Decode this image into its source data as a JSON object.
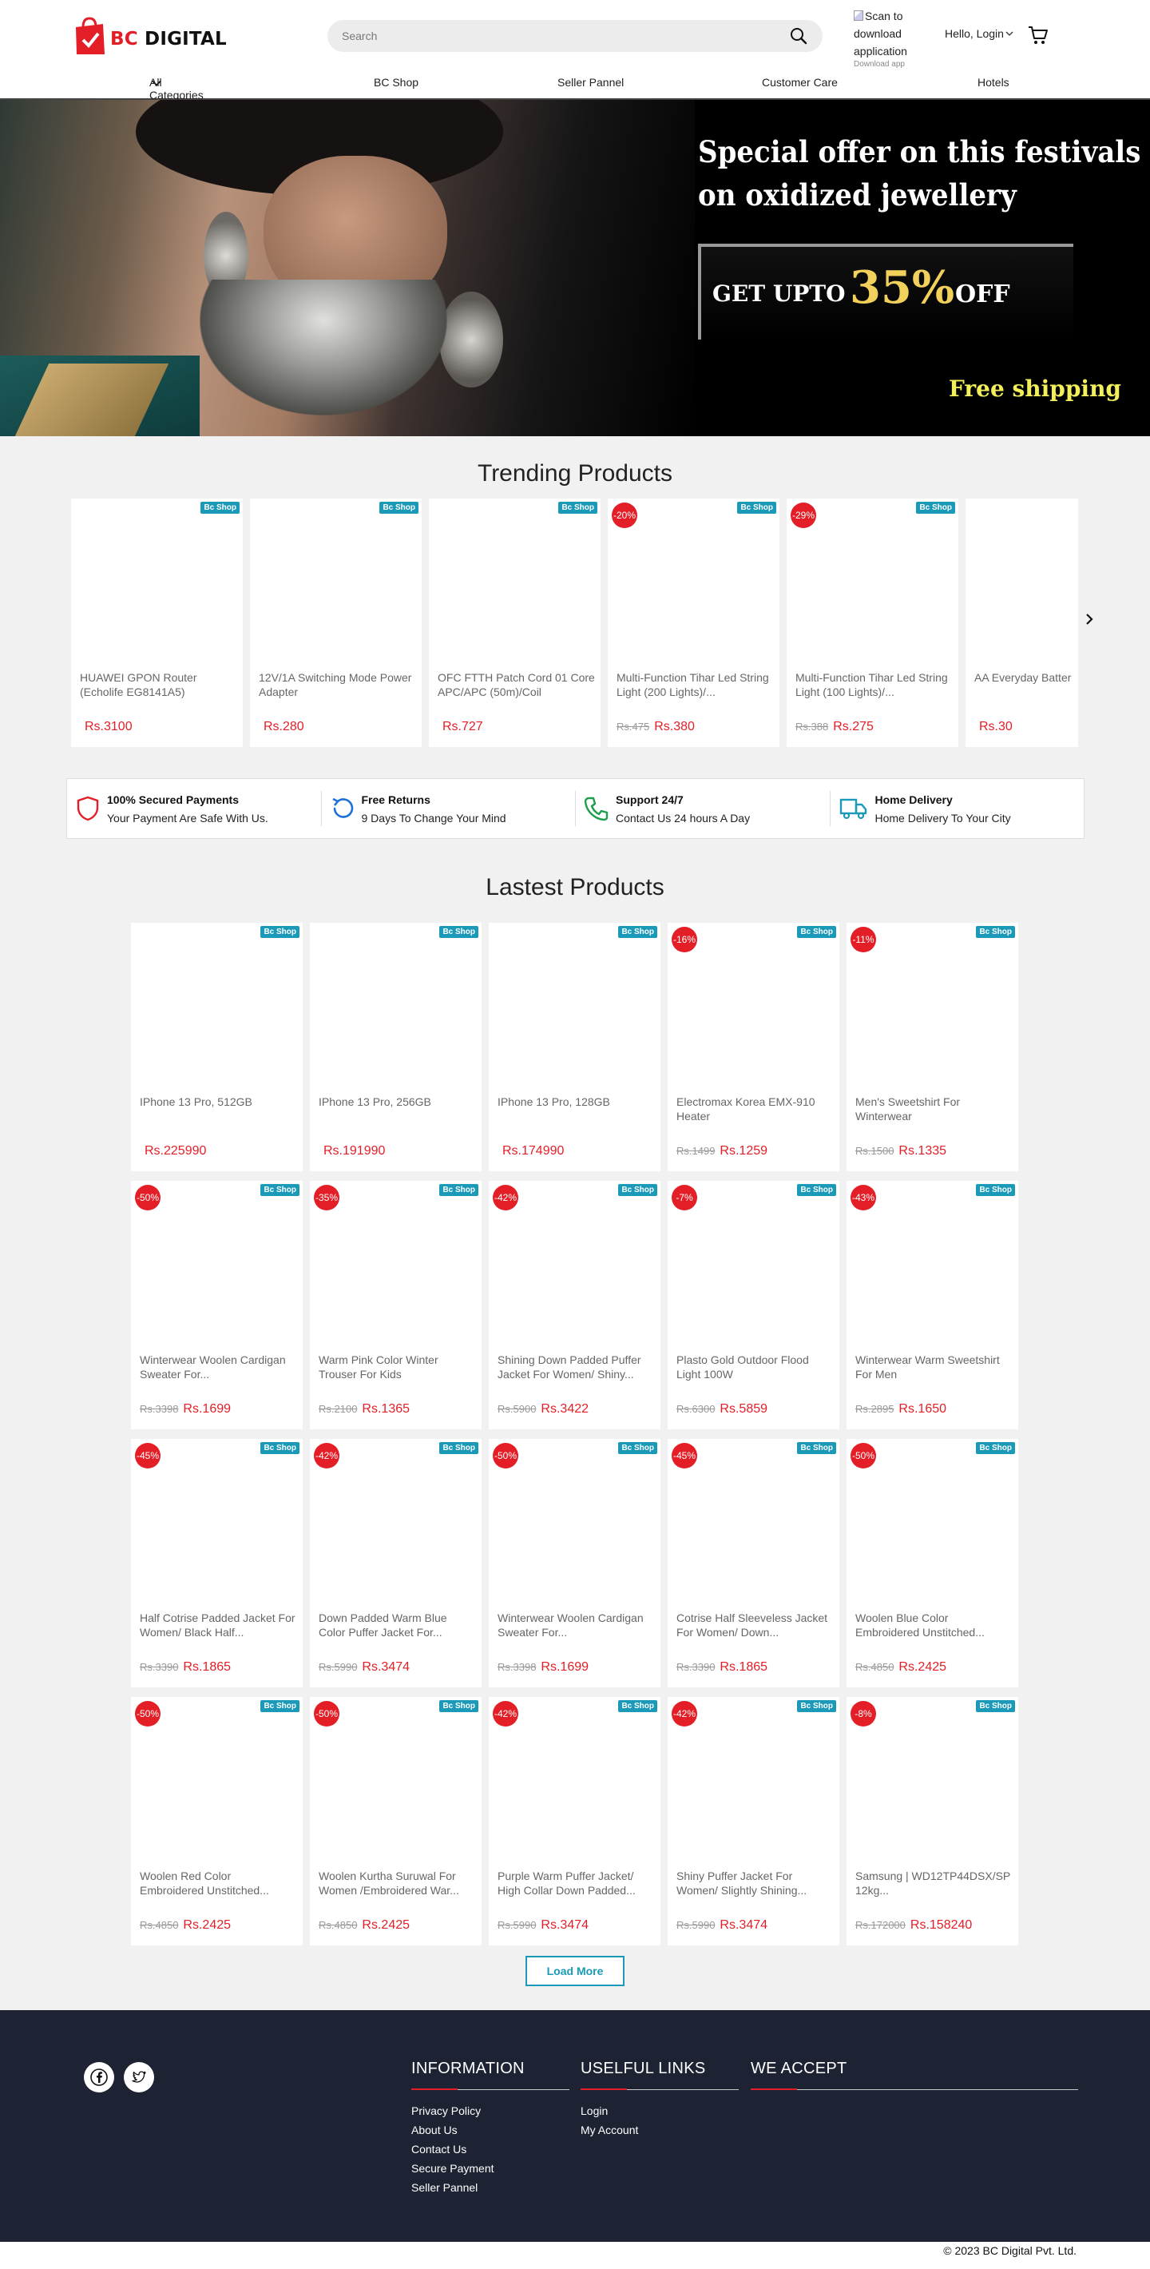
{
  "header": {
    "logo": {
      "bc": "BC",
      "digital": "DIGITAL"
    },
    "search_placeholder": "Search",
    "app": {
      "qr_alt": "Scan to download application",
      "download_label": "Download app"
    },
    "login_label": "Hello, Login",
    "nav": [
      "All Categories",
      "BC Shop",
      "Seller Pannel",
      "Customer Care",
      "Hotels"
    ]
  },
  "banner": {
    "line1": "Special offer on this festivals",
    "line2": "on oxidized jewellery",
    "get_upto": "GET UPTO",
    "percent": "35%",
    "off": "OFF",
    "shipping": "Free shipping"
  },
  "trending": {
    "title": "Trending Products",
    "products": [
      {
        "shop": "Bc Shop",
        "discount": "",
        "name": "HUAWEI GPON Router (Echolife EG8141A5)",
        "old_price": "",
        "price": "Rs.3100"
      },
      {
        "shop": "Bc Shop",
        "discount": "",
        "name": "12V/1A Switching Mode Power Adapter",
        "old_price": "",
        "price": "Rs.280"
      },
      {
        "shop": "Bc Shop",
        "discount": "",
        "name": "OFC FTTH Patch Cord 01 Core APC/APC (50m)/Coil",
        "old_price": "",
        "price": "Rs.727"
      },
      {
        "shop": "Bc Shop",
        "discount": "-20%",
        "name": "Multi-Function Tihar Led String Light (200 Lights)/...",
        "old_price": "Rs.475",
        "price": "Rs.380"
      },
      {
        "shop": "Bc Shop",
        "discount": "-29%",
        "name": "Multi-Function Tihar Led String Light (100 Lights)/...",
        "old_price": "Rs.388",
        "price": "Rs.275"
      },
      {
        "shop": "",
        "discount": "",
        "name": "AA Everyday Batter",
        "old_price": "",
        "price": "Rs.30"
      }
    ]
  },
  "features": [
    {
      "icon": "shield-icon",
      "title": "100% Secured Payments",
      "subtitle": "Your Payment Are Safe With Us."
    },
    {
      "icon": "returns-icon",
      "title": "Free Returns",
      "subtitle": "9 Days To Change Your Mind"
    },
    {
      "icon": "phone-icon",
      "title": "Support 24/7",
      "subtitle": "Contact Us 24 hours A Day"
    },
    {
      "icon": "truck-icon",
      "title": "Home Delivery",
      "subtitle": "Home Delivery To Your City"
    }
  ],
  "latest": {
    "title": "Lastest Products",
    "products": [
      {
        "shop": "Bc Shop",
        "discount": "",
        "name": "IPhone 13 Pro, 512GB",
        "old_price": "",
        "price": "Rs.225990"
      },
      {
        "shop": "Bc Shop",
        "discount": "",
        "name": "IPhone 13 Pro, 256GB",
        "old_price": "",
        "price": "Rs.191990"
      },
      {
        "shop": "Bc Shop",
        "discount": "",
        "name": "IPhone 13 Pro, 128GB",
        "old_price": "",
        "price": "Rs.174990"
      },
      {
        "shop": "Bc Shop",
        "discount": "-16%",
        "name": "Electromax Korea EMX-910 Heater",
        "old_price": "Rs.1499",
        "price": "Rs.1259"
      },
      {
        "shop": "Bc Shop",
        "discount": "-11%",
        "name": "Men's Sweetshirt For Winterwear",
        "old_price": "Rs.1500",
        "price": "Rs.1335"
      },
      {
        "shop": "Bc Shop",
        "discount": "-50%",
        "name": "Winterwear Woolen Cardigan Sweater For...",
        "old_price": "Rs.3398",
        "price": "Rs.1699"
      },
      {
        "shop": "Bc Shop",
        "discount": "-35%",
        "name": "Warm Pink Color Winter Trouser For Kids",
        "old_price": "Rs.2100",
        "price": "Rs.1365"
      },
      {
        "shop": "Bc Shop",
        "discount": "-42%",
        "name": "Shining Down Padded Puffer Jacket For Women/ Shiny...",
        "old_price": "Rs.5900",
        "price": "Rs.3422"
      },
      {
        "shop": "Bc Shop",
        "discount": "-7%",
        "name": "Plasto Gold Outdoor Flood Light 100W",
        "old_price": "Rs.6300",
        "price": "Rs.5859"
      },
      {
        "shop": "Bc Shop",
        "discount": "-43%",
        "name": "Winterwear Warm Sweetshirt For Men",
        "old_price": "Rs.2895",
        "price": "Rs.1650"
      },
      {
        "shop": "Bc Shop",
        "discount": "-45%",
        "name": "Half Cotrise Padded Jacket For Women/ Black Half...",
        "old_price": "Rs.3390",
        "price": "Rs.1865"
      },
      {
        "shop": "Bc Shop",
        "discount": "-42%",
        "name": "Down Padded Warm Blue Color Puffer Jacket For...",
        "old_price": "Rs.5990",
        "price": "Rs.3474"
      },
      {
        "shop": "Bc Shop",
        "discount": "-50%",
        "name": "Winterwear Woolen Cardigan Sweater For...",
        "old_price": "Rs.3398",
        "price": "Rs.1699"
      },
      {
        "shop": "Bc Shop",
        "discount": "-45%",
        "name": "Cotrise Half Sleeveless Jacket For Women/ Down...",
        "old_price": "Rs.3390",
        "price": "Rs.1865"
      },
      {
        "shop": "Bc Shop",
        "discount": "-50%",
        "name": "Woolen Blue Color Embroidered Unstitched...",
        "old_price": "Rs.4850",
        "price": "Rs.2425"
      },
      {
        "shop": "Bc Shop",
        "discount": "-50%",
        "name": "Woolen Red Color Embroidered Unstitched...",
        "old_price": "Rs.4850",
        "price": "Rs.2425"
      },
      {
        "shop": "Bc Shop",
        "discount": "-50%",
        "name": "Woolen Kurtha Suruwal For Women /Embroidered War...",
        "old_price": "Rs.4850",
        "price": "Rs.2425"
      },
      {
        "shop": "Bc Shop",
        "discount": "-42%",
        "name": "Purple Warm Puffer Jacket/ High Collar Down Padded...",
        "old_price": "Rs.5990",
        "price": "Rs.3474"
      },
      {
        "shop": "Bc Shop",
        "discount": "-42%",
        "name": "Shiny Puffer Jacket For Women/ Slightly Shining...",
        "old_price": "Rs.5990",
        "price": "Rs.3474"
      },
      {
        "shop": "Bc Shop",
        "discount": "-8%",
        "name": "Samsung | WD12TP44DSX/SP 12kg...",
        "old_price": "Rs.172000",
        "price": "Rs.158240"
      }
    ],
    "load_more": "Load More"
  },
  "footer": {
    "information": {
      "title": "INFORMATION",
      "links": [
        "Privacy Policy",
        "About Us",
        "Contact Us",
        "Secure Payment",
        "Seller Pannel"
      ]
    },
    "useful": {
      "title": "USELFUL LINKS",
      "links": [
        "Login",
        "My Account"
      ]
    },
    "accept": {
      "title": "WE ACCEPT"
    },
    "copyright_prefix": "© 2023",
    "company": "BC Digital Pvt. Ltd."
  },
  "colors": {
    "brand_red": "#e41e26",
    "shop_badge": "#1a9ab8",
    "footer_bg": "#1d2333"
  }
}
